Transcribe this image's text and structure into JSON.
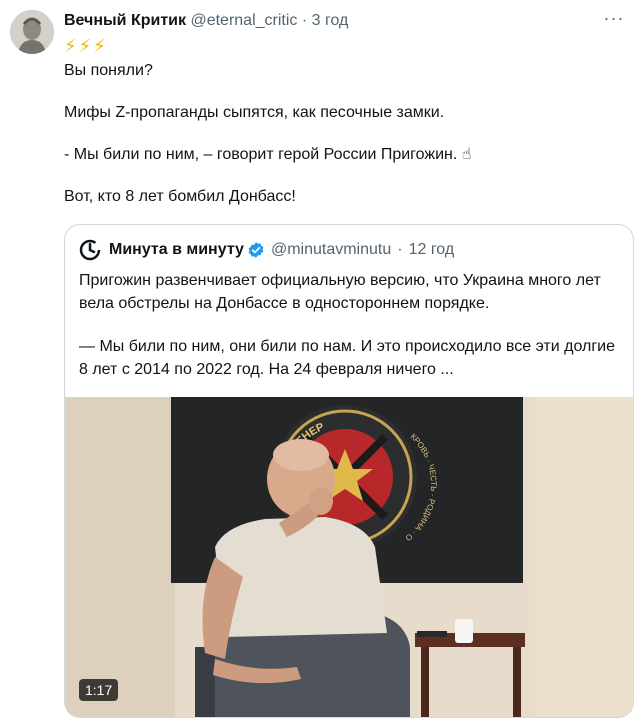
{
  "author": {
    "name": "Вечный Критик",
    "handle": "@eternal_critic",
    "separator": "·",
    "time": "3 год"
  },
  "more_label": "···",
  "tweet": {
    "emoji_line": "⚡⚡⚡",
    "paragraphs": [
      "Вы поняли?",
      "Мифы Z-пропаганды сыпятся, как песочные замки.",
      "- Мы били по ним, – говорит герой России Пригожин. ☝",
      "Вот, кто 8 лет бомбил Донбасс!"
    ]
  },
  "quote": {
    "name": "Минута в минуту",
    "handle": "@minutavminutu",
    "separator": "·",
    "time": "12 год",
    "paragraphs": [
      "Пригожин развенчивает официальную версию, что Украина много лет вела обстрелы на Донбассе в одностороннем порядке.",
      "— Мы били по ним, они били по нам. И это происходило все эти долгие 8 лет с 2014 по 2022 год. На 24 февраля ничего ..."
    ],
    "flag_text": "ЧВК ВАГНЕР",
    "flag_side_text": "КРОВЬ · ЧЕСТЬ · РОДИНА · ОТВАГА",
    "video_duration": "1:17"
  }
}
